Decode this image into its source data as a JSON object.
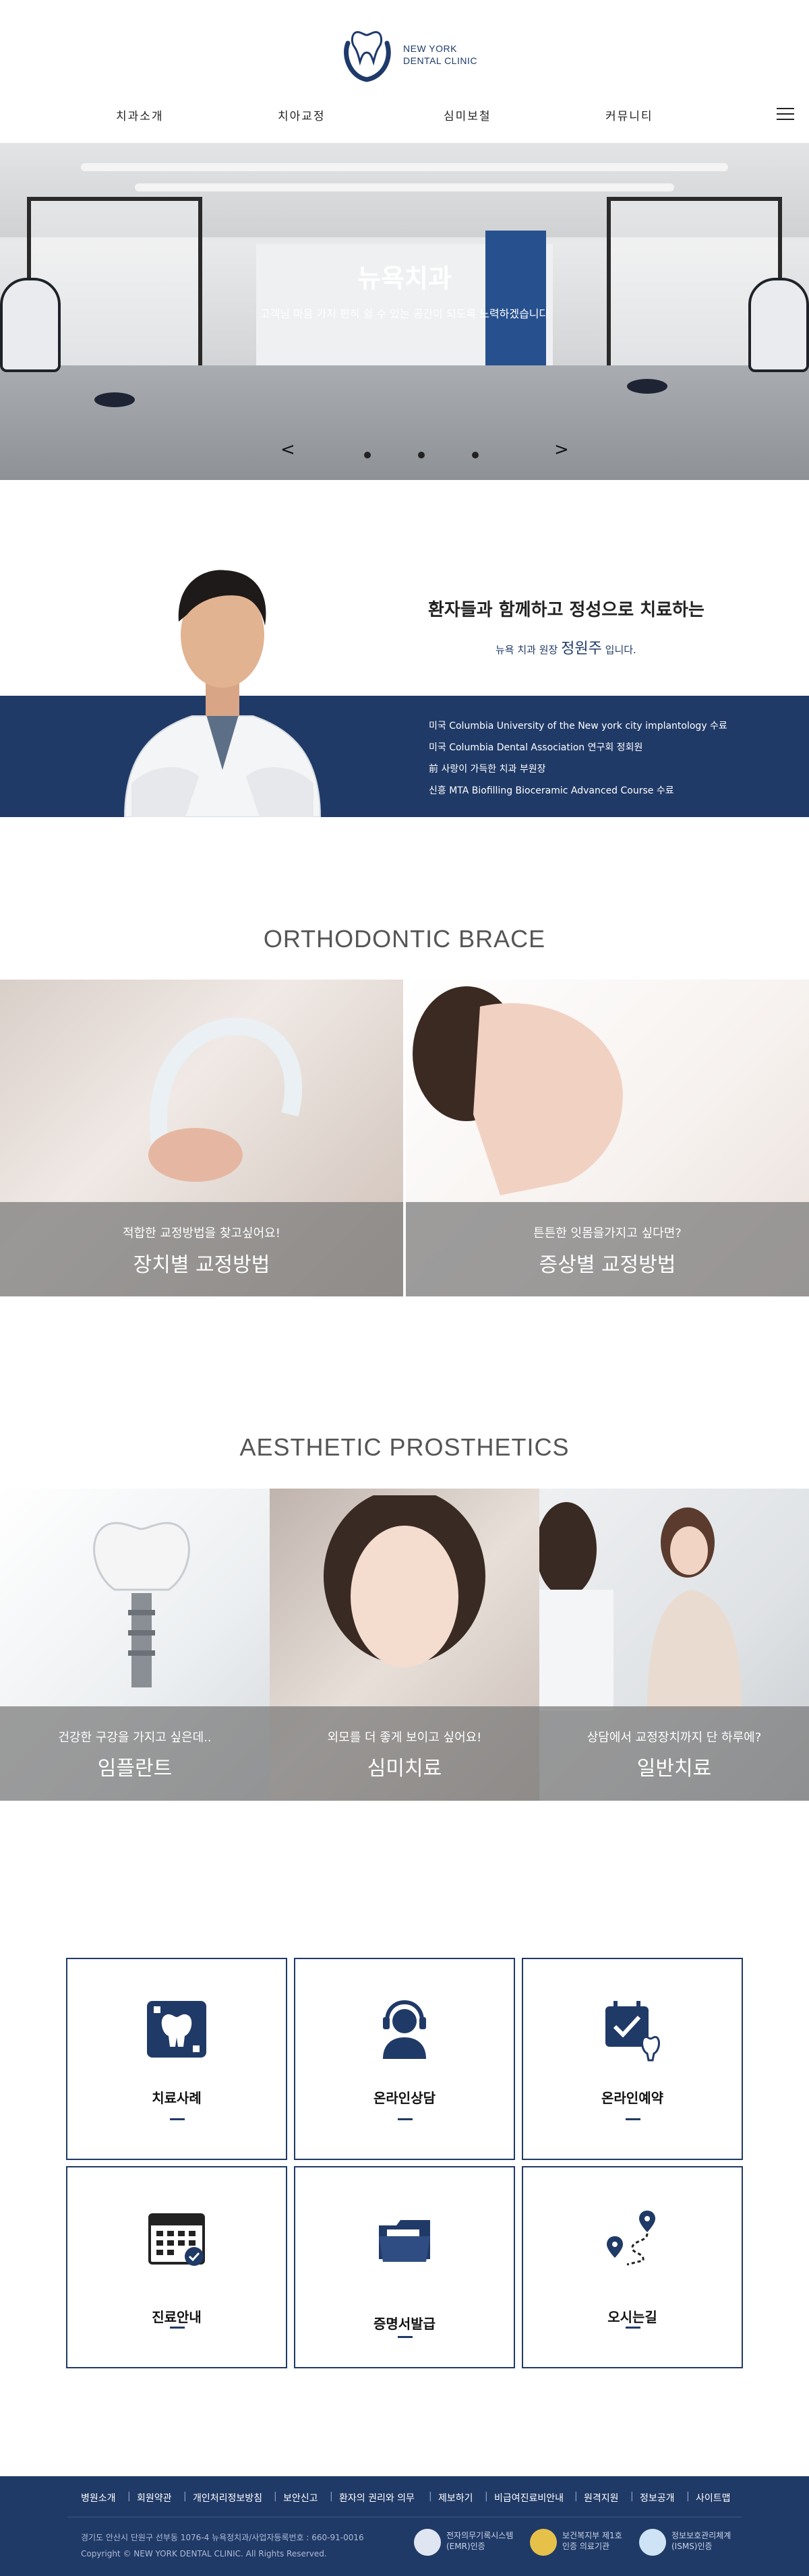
{
  "header": {
    "logo_line1": "NEW YORK",
    "logo_line2": "DENTAL CLINIC",
    "nav": [
      {
        "label": "치과소개"
      },
      {
        "label": "치아교정"
      },
      {
        "label": "심미보철"
      },
      {
        "label": "커뮤니티"
      }
    ]
  },
  "hero": {
    "title": "뉴욕치과",
    "subtitle": "고객님 마음 가지 편히 쉴 수 있는 공간이 되도록 노력하겠습니다",
    "prev": "<",
    "next": ">",
    "slides": 3,
    "active_slide": 1
  },
  "doctor": {
    "heading": "환자들과 함께하고 정성으로 치료하는",
    "intro_prefix": "뉴욕 치과  원장",
    "name": "정원주",
    "intro_suffix": "입니다.",
    "credentials": [
      "미국 Columbia University of the New york city implantology 수료",
      "미국 Columbia Dental Association 연구회 정회원",
      "前 사랑이 가득한 치과 부원장",
      "신흥 MTA Biofilling Bioceramic Advanced Course 수료"
    ]
  },
  "ortho": {
    "title": "ORTHODONTIC BRACE",
    "tiles": [
      {
        "small": "적합한 교정방법을 찾고싶어요!",
        "big": "장치별 교정방법"
      },
      {
        "small": "튼튼한 잇몸을가지고 싶다면?",
        "big": "증상별 교정방법"
      }
    ]
  },
  "aesthetic": {
    "title": "AESTHETIC PROSTHETICS",
    "tiles": [
      {
        "small": "건강한 구강을 가지고 싶은데..",
        "big": "임플란트"
      },
      {
        "small": "외모를 더 좋게 보이고 싶어요!",
        "big": "심미치료"
      },
      {
        "small": "상담에서 교정장치까지 단 하루에?",
        "big": "일반치료"
      }
    ]
  },
  "services": [
    {
      "label": "치료사례",
      "icon": "tooth-case-icon"
    },
    {
      "label": "온라인상담",
      "icon": "headset-icon"
    },
    {
      "label": "온라인예약",
      "icon": "calendar-tooth-icon"
    },
    {
      "label": "진료안내",
      "icon": "calendar-icon"
    },
    {
      "label": "증명서발급",
      "icon": "folder-icon"
    },
    {
      "label": "오시는길",
      "icon": "map-pin-icon"
    }
  ],
  "footer": {
    "links": [
      "병원소개",
      "회원약관",
      "개인처리정보방침",
      "보안신고",
      "환자의 권리와 의무",
      "제보하기",
      "비급여진료비안내",
      "원격지원",
      "정보공개",
      "사이트맵"
    ],
    "address": "경기도 안산시 단원구 선부동 1076-4 뉴욕정치과/사업자등록번호 : 660-91-0016",
    "copyright": "Copyright © NEW YORK DENTAL CLINIC. All Rights Reserved.",
    "badges": [
      {
        "line1": "전자의무기록시스템",
        "line2": "(EMR)인증"
      },
      {
        "line1": "보건복지부 제1호",
        "line2": "인증 의료기관"
      },
      {
        "line1": "정보보호관리체계",
        "line2": "(ISMS)인증"
      }
    ],
    "colors": {
      "navy": "#203a67"
    }
  }
}
